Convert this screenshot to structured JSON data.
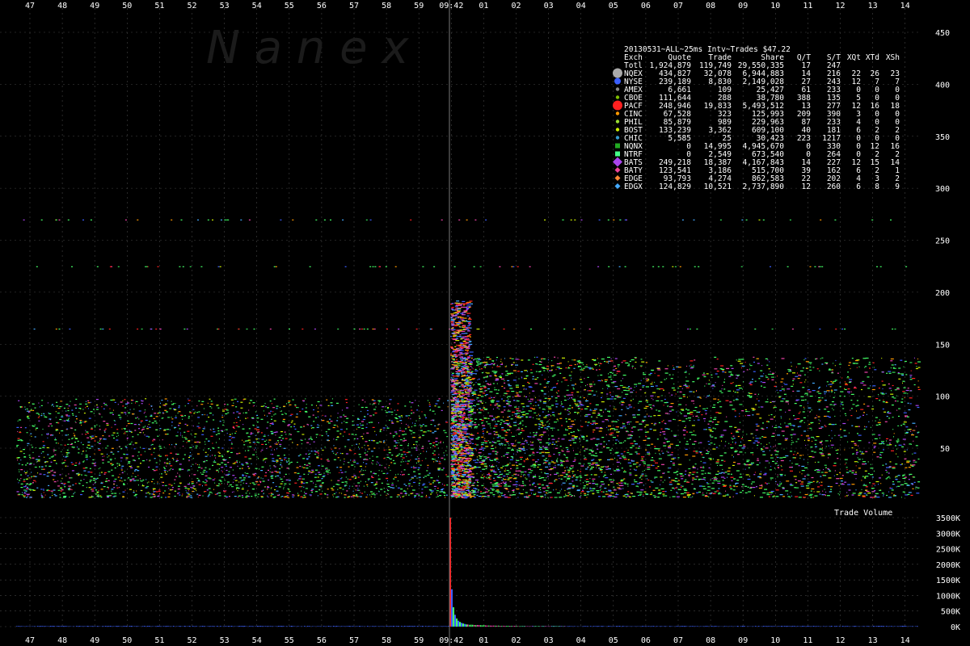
{
  "watermark": "N a n e x",
  "chart_data": [
    {
      "type": "scatter",
      "title": "20130531~ALL~25ms Intv~Trades $47.22",
      "x_ticks_top": [
        "47",
        "48",
        "49",
        "50",
        "51",
        "52",
        "53",
        "54",
        "55",
        "56",
        "57",
        "58",
        "59",
        "09:42",
        "01",
        "02",
        "03",
        "04",
        "05",
        "06",
        "07",
        "08",
        "09",
        "10",
        "11",
        "12",
        "13",
        "14"
      ],
      "x_ticks_bottom": [
        "47",
        "48",
        "49",
        "50",
        "51",
        "52",
        "53",
        "54",
        "55",
        "56",
        "57",
        "58",
        "59",
        "09:42",
        "01",
        "02",
        "03",
        "04",
        "05",
        "06",
        "07",
        "08",
        "09",
        "10",
        "11",
        "12",
        "13",
        "14"
      ],
      "ylim": [
        0,
        460
      ],
      "y_ticks": [
        50,
        100,
        150,
        200,
        250,
        300,
        350,
        400,
        450
      ],
      "grid": true,
      "series_colors": {
        "NQEX": "#aaaaaa",
        "NYSE": "#3a5fff",
        "AMEX": "#888888",
        "CBOE": "#7fbf00",
        "PACF": "#ff2020",
        "CINC": "#ff9900",
        "PHIL": "#99dd33",
        "BOST": "#ccee00",
        "CHIC": "#3399cc",
        "NQNX": "#22aa22",
        "NTRF": "#44ff88",
        "BATS": "#aa44ee",
        "BATY": "#ee4499",
        "EDGE": "#ff8833",
        "EDGX": "#44aaff"
      },
      "table": {
        "headers": [
          "Exch",
          "Quote",
          "Trade",
          "Share",
          "Q/T",
          "S/T",
          "XQt",
          "XTd",
          "XSh"
        ],
        "rows": [
          {
            "exch": "Totl",
            "quote": "1,924,879",
            "trade": "119,749",
            "share": "29,550,335",
            "qt": "17",
            "st": "247",
            "xqt": "",
            "xtd": "",
            "xsh": "",
            "color": "",
            "marker": "none"
          },
          {
            "exch": "NQEX",
            "quote": "434,827",
            "trade": "32,078",
            "share": "6,944,883",
            "qt": "14",
            "st": "216",
            "xqt": "22",
            "xtd": "26",
            "xsh": "23",
            "color": "#aaaaaa",
            "marker": "big-circle"
          },
          {
            "exch": "NYSE",
            "quote": "239,189",
            "trade": "8,830",
            "share": "2,149,028",
            "qt": "27",
            "st": "243",
            "xqt": "12",
            "xtd": "7",
            "xsh": "7",
            "color": "#3a5fff",
            "marker": "circle"
          },
          {
            "exch": "AMEX",
            "quote": "6,661",
            "trade": "109",
            "share": "25,427",
            "qt": "61",
            "st": "233",
            "xqt": "0",
            "xtd": "0",
            "xsh": "0",
            "color": "#888888",
            "marker": "dot"
          },
          {
            "exch": "CBOE",
            "quote": "111,644",
            "trade": "288",
            "share": "38,780",
            "qt": "388",
            "st": "135",
            "xqt": "5",
            "xtd": "0",
            "xsh": "0",
            "color": "#7fbf00",
            "marker": "dot"
          },
          {
            "exch": "PACF",
            "quote": "248,946",
            "trade": "19,833",
            "share": "5,493,512",
            "qt": "13",
            "st": "277",
            "xqt": "12",
            "xtd": "16",
            "xsh": "18",
            "color": "#ff2020",
            "marker": "big-circle"
          },
          {
            "exch": "CINC",
            "quote": "67,528",
            "trade": "323",
            "share": "125,993",
            "qt": "209",
            "st": "390",
            "xqt": "3",
            "xtd": "0",
            "xsh": "0",
            "color": "#ff9900",
            "marker": "dot"
          },
          {
            "exch": "PHIL",
            "quote": "85,879",
            "trade": "989",
            "share": "229,963",
            "qt": "87",
            "st": "233",
            "xqt": "4",
            "xtd": "0",
            "xsh": "0",
            "color": "#99dd33",
            "marker": "dot"
          },
          {
            "exch": "BOST",
            "quote": "133,239",
            "trade": "3,362",
            "share": "609,100",
            "qt": "40",
            "st": "181",
            "xqt": "6",
            "xtd": "2",
            "xsh": "2",
            "color": "#ccee00",
            "marker": "dot"
          },
          {
            "exch": "CHIC",
            "quote": "5,585",
            "trade": "25",
            "share": "30,423",
            "qt": "223",
            "st": "1217",
            "xqt": "0",
            "xtd": "0",
            "xsh": "0",
            "color": "#3399cc",
            "marker": "dot"
          },
          {
            "exch": "NQNX",
            "quote": "0",
            "trade": "14,995",
            "share": "4,945,670",
            "qt": "0",
            "st": "330",
            "xqt": "0",
            "xtd": "12",
            "xsh": "16",
            "color": "#22aa22",
            "marker": "square"
          },
          {
            "exch": "NTRF",
            "quote": "0",
            "trade": "2,549",
            "share": "673,540",
            "qt": "0",
            "st": "264",
            "xqt": "0",
            "xtd": "2",
            "xsh": "2",
            "color": "#44ff88",
            "marker": "square"
          },
          {
            "exch": "BATS",
            "quote": "249,218",
            "trade": "18,387",
            "share": "4,167,843",
            "qt": "14",
            "st": "227",
            "xqt": "12",
            "xtd": "15",
            "xsh": "14",
            "color": "#aa44ee",
            "marker": "diamond"
          },
          {
            "exch": "BATY",
            "quote": "123,541",
            "trade": "3,186",
            "share": "515,700",
            "qt": "39",
            "st": "162",
            "xqt": "6",
            "xtd": "2",
            "xsh": "1",
            "color": "#ee4499",
            "marker": "small-diamond"
          },
          {
            "exch": "EDGE",
            "quote": "93,793",
            "trade": "4,274",
            "share": "862,583",
            "qt": "22",
            "st": "202",
            "xqt": "4",
            "xtd": "3",
            "xsh": "2",
            "color": "#ff8833",
            "marker": "small-diamond"
          },
          {
            "exch": "EDGX",
            "quote": "124,829",
            "trade": "10,521",
            "share": "2,737,890",
            "qt": "12",
            "st": "260",
            "xqt": "6",
            "xtd": "8",
            "xsh": "9",
            "color": "#44aaff",
            "marker": "small-diamond"
          }
        ]
      }
    },
    {
      "type": "bar",
      "title": "Trade Volume",
      "ylim": [
        0,
        3500
      ],
      "y_ticks": [
        "0K",
        "500K",
        "1000K",
        "1500K",
        "2000K",
        "2500K",
        "3000K",
        "3500K"
      ],
      "unit": "K",
      "spike_value_k": 3500,
      "baseline_value_k": 20,
      "decay_values_k": [
        1200,
        620,
        380,
        260,
        190,
        150,
        120,
        100,
        85,
        70
      ]
    }
  ]
}
